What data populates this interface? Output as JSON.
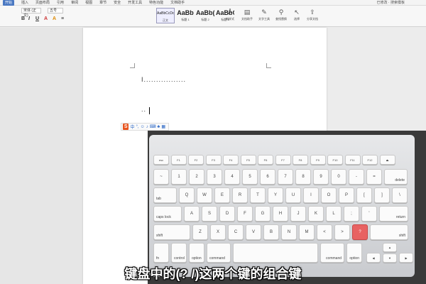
{
  "menu": [
    "开始",
    "插入",
    "页面布局",
    "引用",
    "审阅",
    "视图",
    "章节",
    "安全",
    "开发工具",
    "特色功能",
    "文档助手"
  ],
  "window": {
    "right_text": "已修改 · 搜索模板"
  },
  "ribbon": {
    "font_name": "宋体 (正文)",
    "font_size": "五号",
    "styles": [
      {
        "preview": "AaBbCcDd",
        "name": "正文"
      },
      {
        "preview": "AaBb",
        "name": "标题 1"
      },
      {
        "preview": "AaBb(",
        "name": "标题 2"
      },
      {
        "preview": "AaBbC",
        "name": "标题 3"
      }
    ],
    "tools": [
      {
        "icon": "Å",
        "label": "新样式"
      },
      {
        "icon": "▤",
        "label": "文档助手"
      },
      {
        "icon": "✎",
        "label": "文字工具"
      },
      {
        "icon": "⚲",
        "label": "查找替换"
      },
      {
        "icon": "↖",
        "label": "选择"
      },
      {
        "icon": "⇪",
        "label": "分享文档"
      }
    ]
  },
  "document": {
    "line1": "I.................",
    "line2": ".."
  },
  "ime": {
    "logo": "S"
  },
  "keyboard": {
    "row_fn": [
      "esc",
      "F1",
      "F2",
      "F3",
      "F4",
      "F5",
      "F6",
      "F7",
      "F8",
      "F9",
      "F10",
      "F11",
      "F12",
      "⏏"
    ],
    "row_num": [
      "~",
      "1",
      "2",
      "3",
      "4",
      "5",
      "6",
      "7",
      "8",
      "9",
      "0",
      "-",
      "=",
      "delete"
    ],
    "row_q": [
      "tab",
      "Q",
      "W",
      "E",
      "R",
      "T",
      "Y",
      "U",
      "I",
      "O",
      "P",
      "[",
      "]",
      "\\"
    ],
    "row_a": [
      "caps lock",
      "A",
      "S",
      "D",
      "F",
      "G",
      "H",
      "J",
      "K",
      "L",
      ";",
      "'",
      "return"
    ],
    "row_z": [
      "shift",
      "Z",
      "X",
      "C",
      "V",
      "B",
      "N",
      "M",
      "<",
      ">",
      "?",
      "shift"
    ],
    "row_bottom": [
      "fn",
      "control",
      "option",
      "command",
      "",
      "command",
      "option"
    ],
    "highlight_key": "?"
  },
  "subtitle": "键盘中的(? /)这两个键的组合键"
}
